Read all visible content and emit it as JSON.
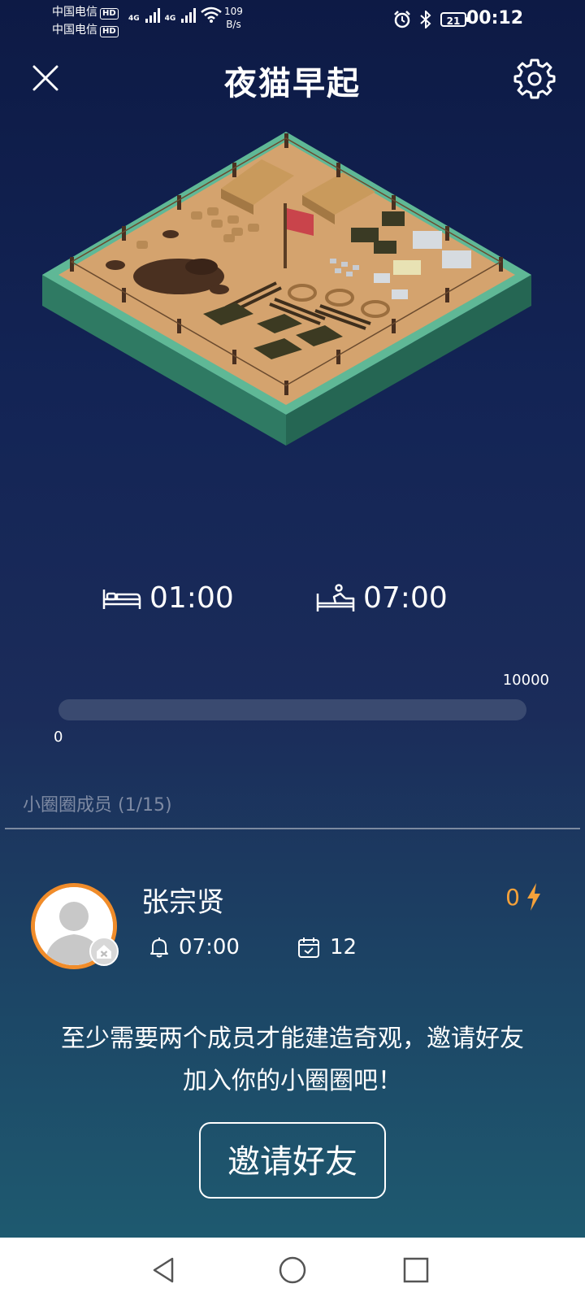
{
  "status_bar": {
    "carrier1": "中国电信",
    "carrier2": "中国电信",
    "hd_label": "HD",
    "signal1_label": "4G",
    "signal2_label": "4G",
    "net_speed_value": "109",
    "net_speed_unit": "B/s",
    "battery": "21",
    "time": "00:12"
  },
  "header": {
    "title": "夜猫早起"
  },
  "sleep": {
    "bed_time": "01:00",
    "wake_time": "07:00"
  },
  "progress": {
    "min": "0",
    "max": "10000",
    "value": 0
  },
  "members": {
    "heading": "小圈圈成员 (1/15)",
    "list": [
      {
        "name": "张宗贤",
        "energy": "0",
        "alarm_time": "07:00",
        "days": "12"
      }
    ]
  },
  "invite": {
    "message_line1": "至少需要两个成员才能建造奇观，邀请好友",
    "message_line2": "加入你的小圈圈吧！",
    "button_label": "邀请好友"
  },
  "colors": {
    "accent_orange": "#f5a13a",
    "background_top": "#0d1a45",
    "background_bottom": "#1f5f72"
  }
}
